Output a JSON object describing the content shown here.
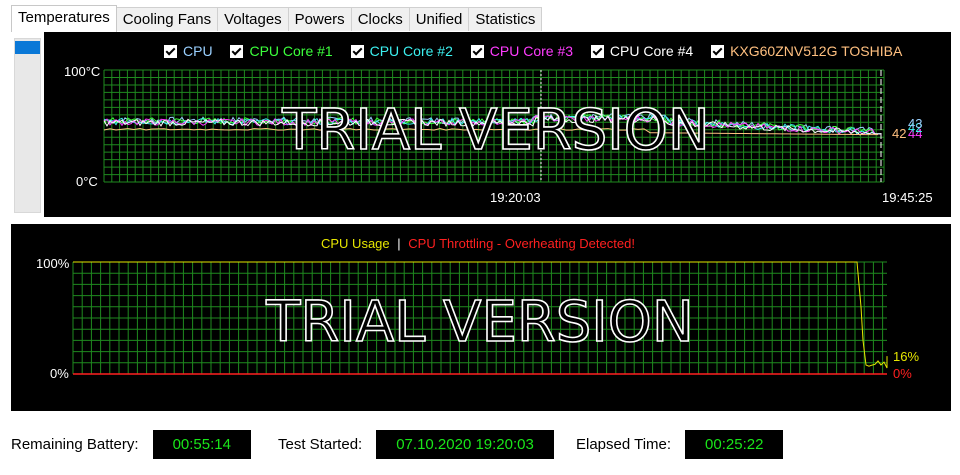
{
  "tabs": [
    {
      "label": "Temperatures",
      "active": true
    },
    {
      "label": "Cooling Fans",
      "active": false
    },
    {
      "label": "Voltages",
      "active": false
    },
    {
      "label": "Powers",
      "active": false
    },
    {
      "label": "Clocks",
      "active": false
    },
    {
      "label": "Unified",
      "active": false
    },
    {
      "label": "Statistics",
      "active": false
    }
  ],
  "temperature_chart": {
    "legend": [
      {
        "name": "CPU",
        "color": "#9ad0ff"
      },
      {
        "name": "CPU Core #1",
        "color": "#3cff3c"
      },
      {
        "name": "CPU Core #2",
        "color": "#3cf0f0"
      },
      {
        "name": "CPU Core #3",
        "color": "#ff3cff"
      },
      {
        "name": "CPU Core #4",
        "color": "#ffffff"
      },
      {
        "name": "KXG60ZNV512G TOSHIBA",
        "color": "#ffc080"
      }
    ],
    "y_top": "100°C",
    "y_bottom": "0°C",
    "x_mid": "19:20:03",
    "x_end": "19:45:25",
    "watermark": "TRIAL VERSION",
    "end_values": [
      {
        "text": "42",
        "color": "#ffc080"
      },
      {
        "text": "44",
        "color": "#ff3cff"
      },
      {
        "text": "42",
        "color": "#3cf0f0"
      },
      {
        "text": "43",
        "color": "#9ad0ff"
      }
    ]
  },
  "usage_chart": {
    "legend_usage": "CPU Usage",
    "legend_sep": "|",
    "legend_throttle": "CPU Throttling - Overheating Detected!",
    "usage_color": "#e6e600",
    "throttle_color": "#ff2020",
    "y_top": "100%",
    "y_bottom": "0%",
    "watermark": "TRIAL VERSION",
    "usage_end": "16%",
    "throttle_end": "0%"
  },
  "status": {
    "battery_label": "Remaining Battery:",
    "battery_value": "00:55:14",
    "started_label": "Test Started:",
    "started_value": "07.10.2020 19:20:03",
    "elapsed_label": "Elapsed Time:",
    "elapsed_value": "00:25:22"
  },
  "chart_data": [
    {
      "type": "line",
      "x_range": [
        "19:20:03",
        "19:45:25"
      ],
      "ylim": [
        0,
        100
      ],
      "ylabel": "°C",
      "series": [
        {
          "name": "CPU",
          "end_value": 43
        },
        {
          "name": "CPU Core #1",
          "end_value": 42
        },
        {
          "name": "CPU Core #2",
          "end_value": 42
        },
        {
          "name": "CPU Core #3",
          "end_value": 44
        },
        {
          "name": "CPU Core #4",
          "end_value": 42
        },
        {
          "name": "KXG60ZNV512G TOSHIBA",
          "end_value": 42
        }
      ]
    },
    {
      "type": "line",
      "ylim": [
        0,
        100
      ],
      "series": [
        {
          "name": "CPU Usage",
          "end_value": 16
        },
        {
          "name": "CPU Throttling - Overheating Detected!",
          "end_value": 0
        }
      ]
    }
  ]
}
